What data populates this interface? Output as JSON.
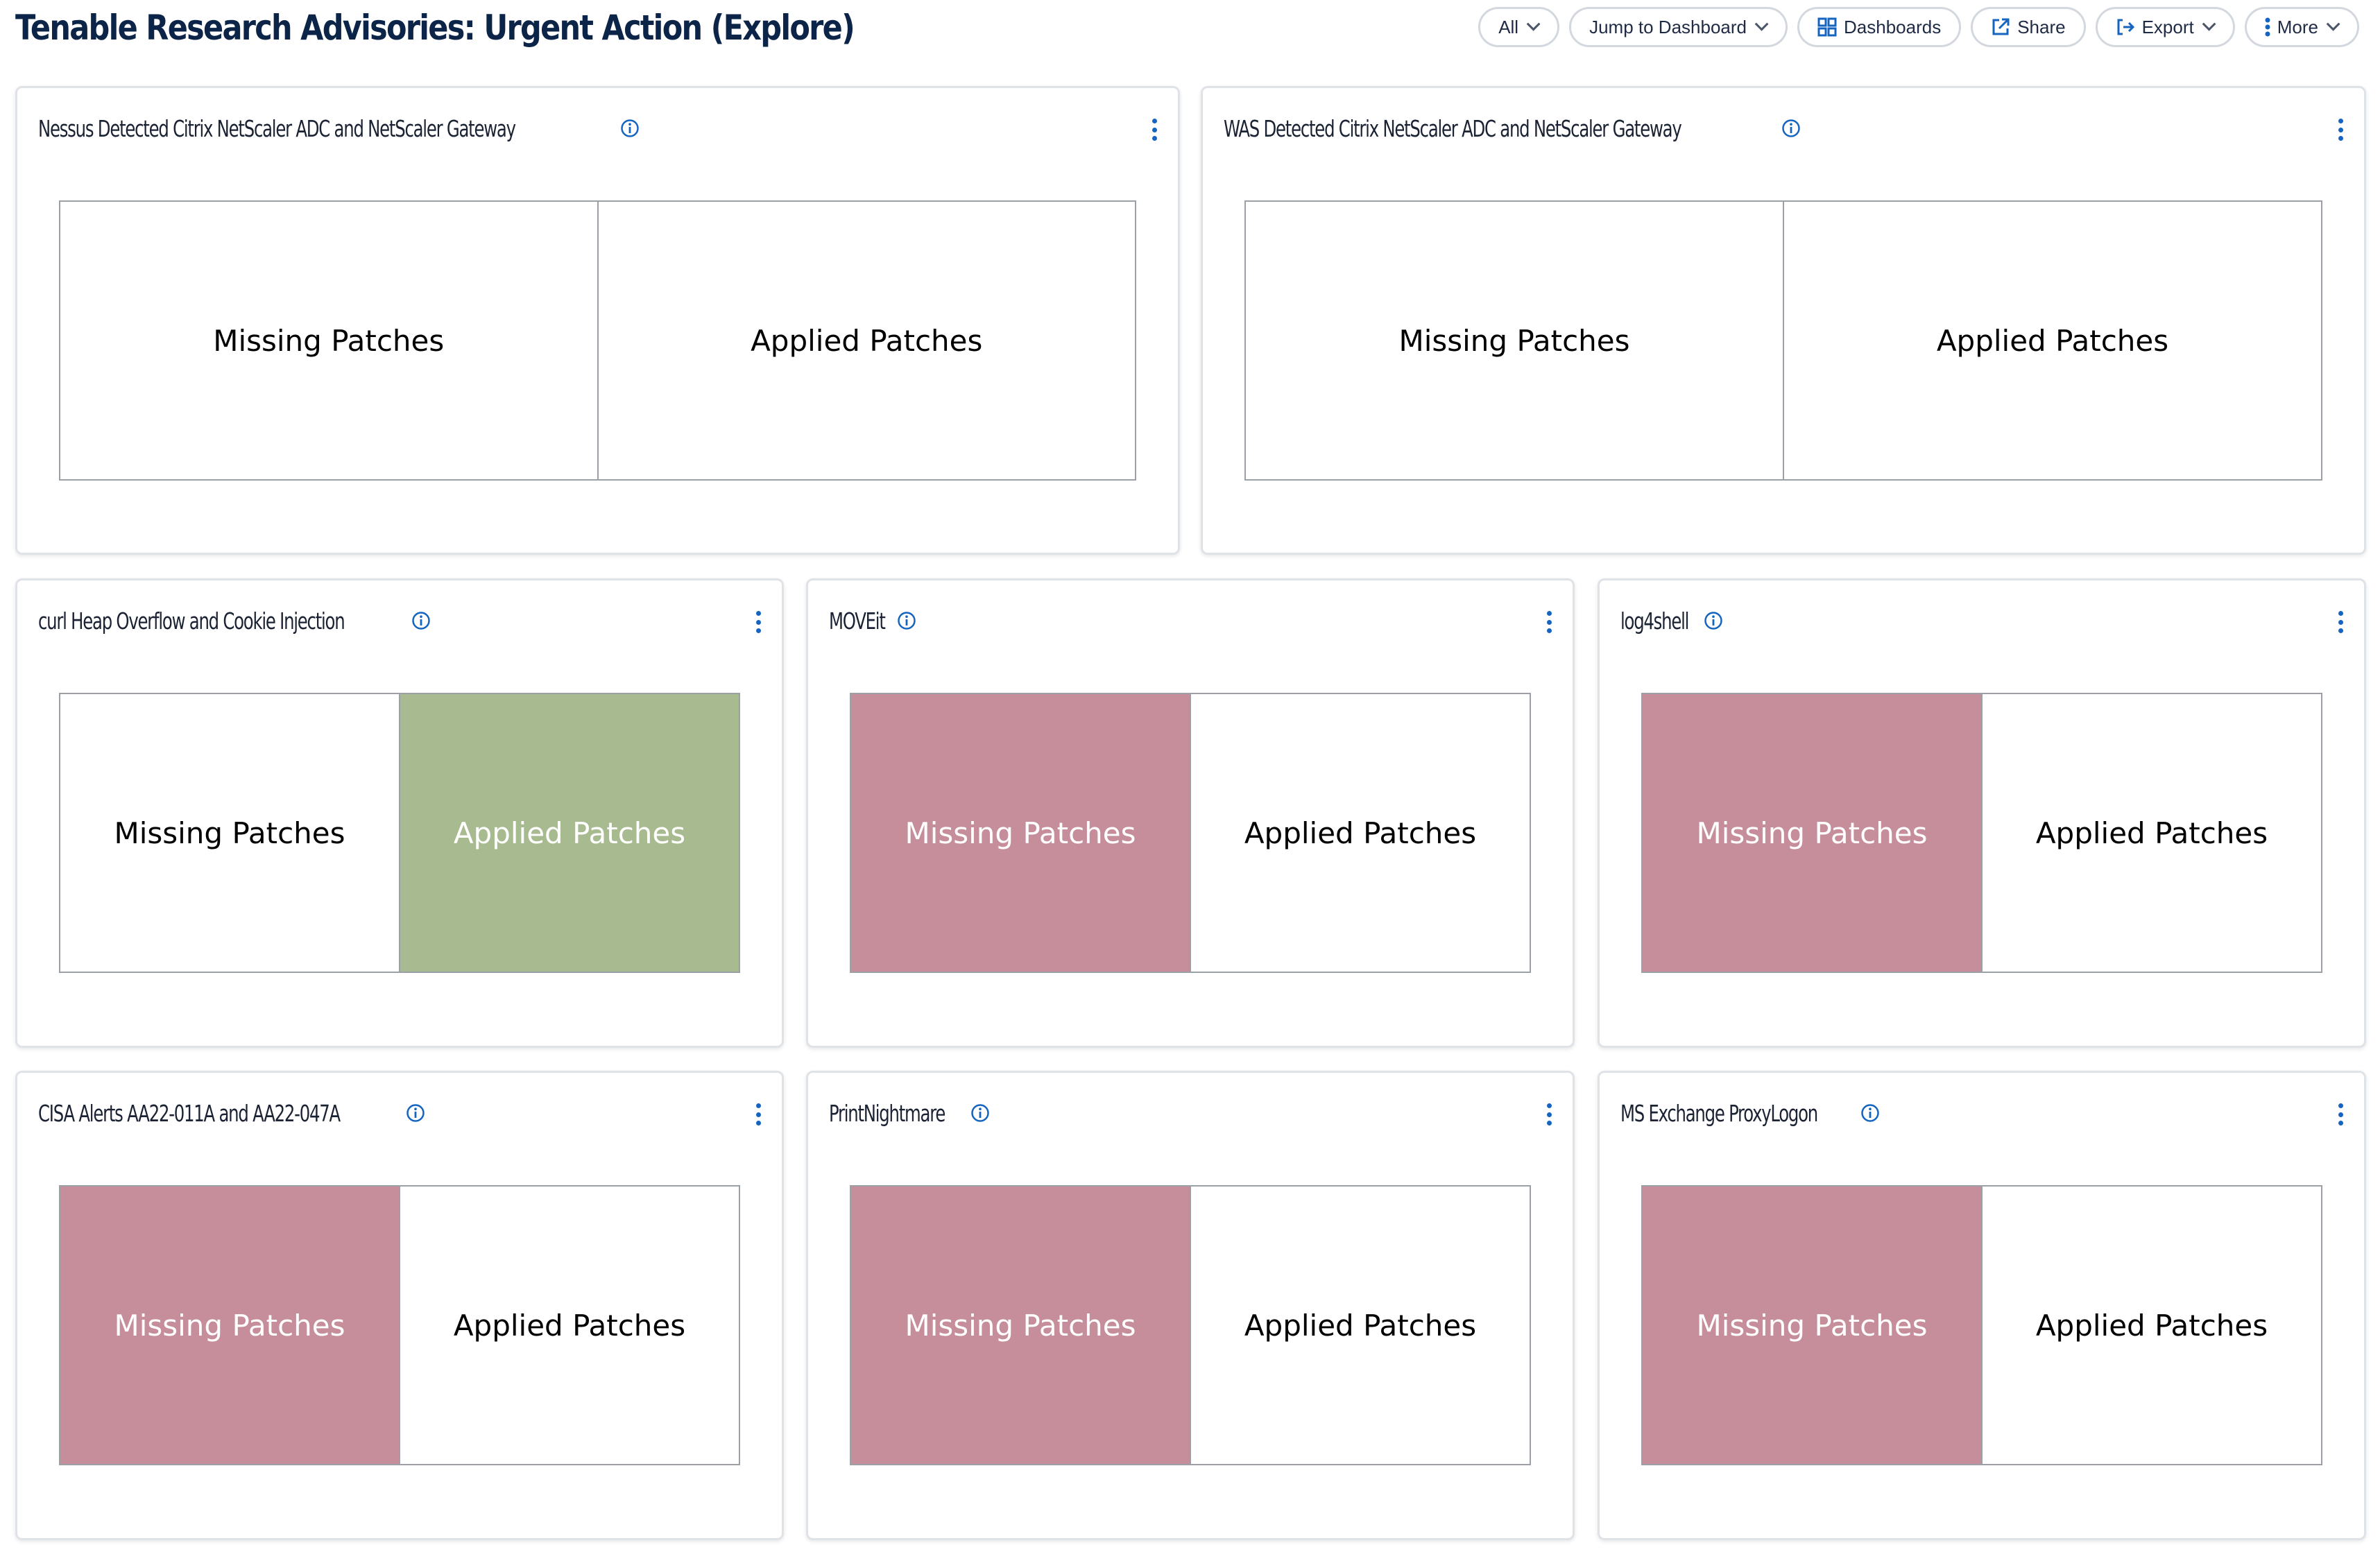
{
  "header": {
    "title": "Tenable Research Advisories: Urgent Action (Explore)",
    "toolbar": {
      "all_label": "All",
      "jump_label": "Jump to Dashboard",
      "dashboards_label": "Dashboards",
      "share_label": "Share",
      "export_label": "Export",
      "more_label": "More"
    }
  },
  "colors": {
    "missing_highlight": "#c68d9b",
    "applied_highlight": "#a8ba8f",
    "accent": "#1565c0"
  },
  "panels": [
    {
      "title": "Nessus Detected Citrix NetScaler ADC and NetScaler Gateway",
      "missing_label": "Missing Patches",
      "applied_label": "Applied Patches",
      "missing_state": "none",
      "applied_state": "none"
    },
    {
      "title": "WAS Detected Citrix NetScaler ADC and NetScaler Gateway",
      "missing_label": "Missing Patches",
      "applied_label": "Applied Patches",
      "missing_state": "none",
      "applied_state": "none"
    },
    {
      "title": "curl Heap Overflow and Cookie Injection",
      "missing_label": "Missing Patches",
      "applied_label": "Applied Patches",
      "missing_state": "none",
      "applied_state": "green"
    },
    {
      "title": "MOVEit",
      "missing_label": "Missing Patches",
      "applied_label": "Applied Patches",
      "missing_state": "red",
      "applied_state": "none"
    },
    {
      "title": "log4shell",
      "missing_label": "Missing Patches",
      "applied_label": "Applied Patches",
      "missing_state": "red",
      "applied_state": "none"
    },
    {
      "title": "CISA Alerts AA22-011A and AA22-047A",
      "missing_label": "Missing Patches",
      "applied_label": "Applied Patches",
      "missing_state": "red",
      "applied_state": "none"
    },
    {
      "title": "PrintNightmare",
      "missing_label": "Missing Patches",
      "applied_label": "Applied Patches",
      "missing_state": "red",
      "applied_state": "none"
    },
    {
      "title": "MS Exchange ProxyLogon",
      "missing_label": "Missing Patches",
      "applied_label": "Applied Patches",
      "missing_state": "red",
      "applied_state": "none"
    }
  ]
}
